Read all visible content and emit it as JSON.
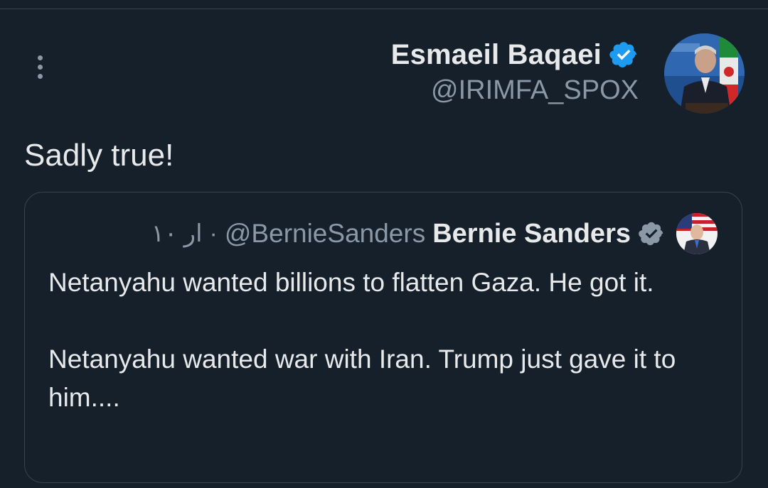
{
  "tweet": {
    "author_name": "Esmaeil Baqaei",
    "author_handle": "@IRIMFA_SPOX",
    "text": "Sadly true!",
    "verified_color": "#1d9bf0"
  },
  "quoted_tweet": {
    "author_name": "Bernie Sanders",
    "author_handle": "@BernieSanders",
    "time": "۱۰ ار",
    "separator": "·",
    "verified_color": "#8b98a5",
    "paragraphs": [
      "Netanyahu wanted billions to flatten Gaza. He got it.",
      "Netanyahu wanted war with Iran. Trump just gave it to him...."
    ]
  },
  "icons": {
    "more": "more-vertical-icon",
    "verified": "verified-badge-icon"
  },
  "colors": {
    "background": "#15202b",
    "border": "#38444d",
    "primary_text": "#e7e9ea",
    "secondary_text": "#8b98a5"
  }
}
